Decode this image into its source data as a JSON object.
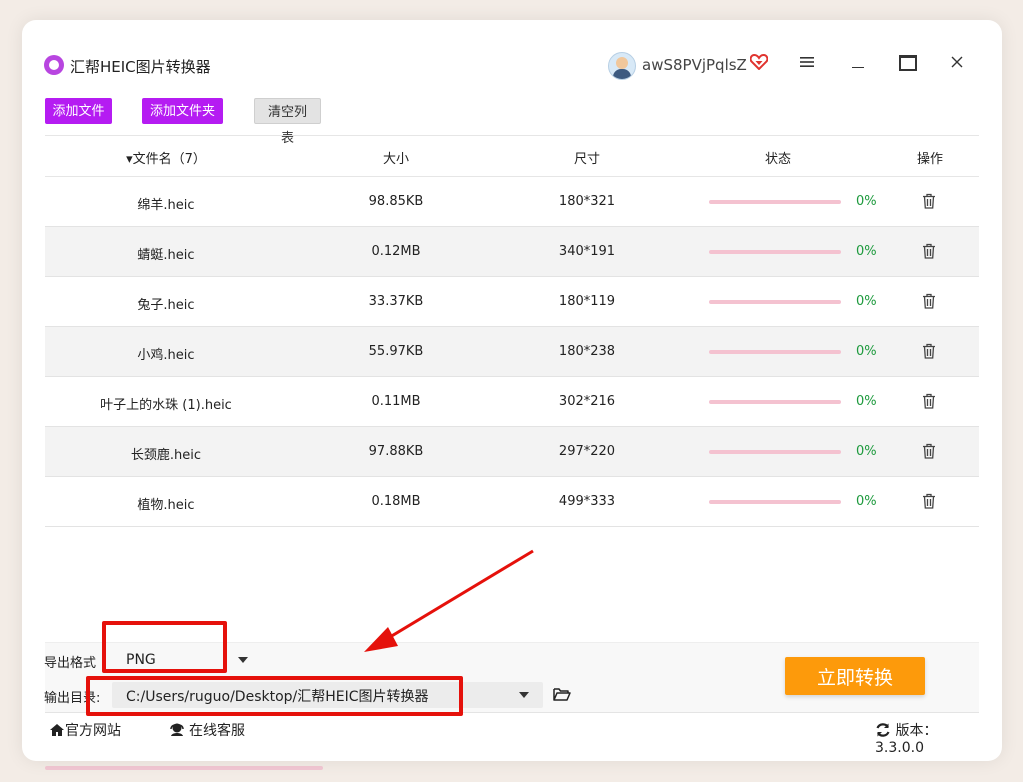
{
  "window": {
    "title": "汇帮HEIC图片转换器",
    "username": "awS8PVjPqlsZ",
    "icons": [
      "app-logo-icon",
      "avatar-icon",
      "vip-heart-icon",
      "menu-icon",
      "minimize-icon",
      "maximize-icon",
      "close-icon"
    ]
  },
  "toolbar": {
    "add_file": "添加文件",
    "add_folder": "添加文件夹",
    "clear_list": "清空列表"
  },
  "table": {
    "headers": {
      "filename": "▾文件名（7）",
      "size": "大小",
      "dimensions": "尺寸",
      "status": "状态",
      "actions": "操作"
    },
    "rows": [
      {
        "name": "绵羊.heic",
        "size": "98.85KB",
        "dim": "180*321",
        "progress": 0,
        "pct": "0%"
      },
      {
        "name": "蜻蜓.heic",
        "size": "0.12MB",
        "dim": "340*191",
        "progress": 0,
        "pct": "0%"
      },
      {
        "name": "兔子.heic",
        "size": "33.37KB",
        "dim": "180*119",
        "progress": 0,
        "pct": "0%"
      },
      {
        "name": "小鸡.heic",
        "size": "55.97KB",
        "dim": "180*238",
        "progress": 0,
        "pct": "0%"
      },
      {
        "name": "叶子上的水珠 (1).heic",
        "size": "0.11MB",
        "dim": "302*216",
        "progress": 0,
        "pct": "0%"
      },
      {
        "name": "长颈鹿.heic",
        "size": "97.88KB",
        "dim": "297*220",
        "progress": 0,
        "pct": "0%"
      },
      {
        "name": "植物.heic",
        "size": "0.18MB",
        "dim": "499*333",
        "progress": 0,
        "pct": "0%"
      }
    ]
  },
  "settings": {
    "format_label": "导出格式",
    "format_value": "PNG",
    "output_label": "输出目录:",
    "output_path": "C:/Users/ruguo/Desktop/汇帮HEIC图片转换器",
    "convert_button": "立即转换"
  },
  "statusbar": {
    "official_site": "官方网站",
    "online_service": "在线客服",
    "version": "版本：3.3.0.0"
  },
  "colors": {
    "accent_purple": "#b51cf2",
    "convert_orange": "#fd9a0b",
    "progress_track": "#f4c2d0",
    "percent_green": "#1d9a3d",
    "annotation_red": "#e5110b"
  }
}
